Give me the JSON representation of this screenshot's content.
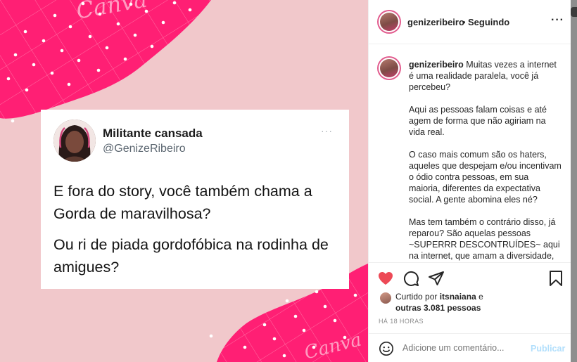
{
  "post": {
    "watermark_top": "Canva",
    "watermark_bottom": "Canva",
    "tweet": {
      "name": "Militante cansada",
      "handle": "@GenizeRibeiro",
      "more": "···",
      "paragraph1": "E fora do story, você também chama a Gorda de maravilhosa?",
      "paragraph2": "Ou ri de piada gordofóbica na rodinha de amigues?"
    }
  },
  "header": {
    "username": "genizeribeiro",
    "separator": "•",
    "follow_status": "Seguindo",
    "more": "···"
  },
  "caption": {
    "username": "genizeribeiro",
    "paragraphs": [
      "Muitas vezes a internet é uma realidade paralela, você já percebeu?",
      "Aqui as pessoas falam coisas e até agem de forma que não agiriam na vida real.",
      "O caso mais comum são os haters, aqueles que despejam e/ou incentivam o ódio contra pessoas, em sua maioria, diferentes da expectativa social. A gente abomina eles né?",
      "Mas tem também o contrário disso, já reparou? São aquelas pessoas ~SUPERRR DESCONTRUÍDES~ aqui na internet, que amam a diversidade, super apoia as causas de minorias"
    ]
  },
  "actions": {
    "liked_prefix": "Curtido por",
    "liked_user": "itsnaiana",
    "liked_and": "e",
    "liked_others": "outras 3.081 pessoas",
    "timestamp": "HÁ 18 HORAS"
  },
  "comment": {
    "placeholder": "Adicione um comentário...",
    "publish_label": "Publicar"
  },
  "colors": {
    "pink_bg": "#f1c8cb",
    "pink_accent": "#ff1f74",
    "like_red": "#ed4956",
    "publish_disabled": "#b2dffc"
  },
  "icons": [
    "heart-icon",
    "comment-icon",
    "share-icon",
    "bookmark-icon",
    "emoji-icon",
    "more-icon"
  ]
}
